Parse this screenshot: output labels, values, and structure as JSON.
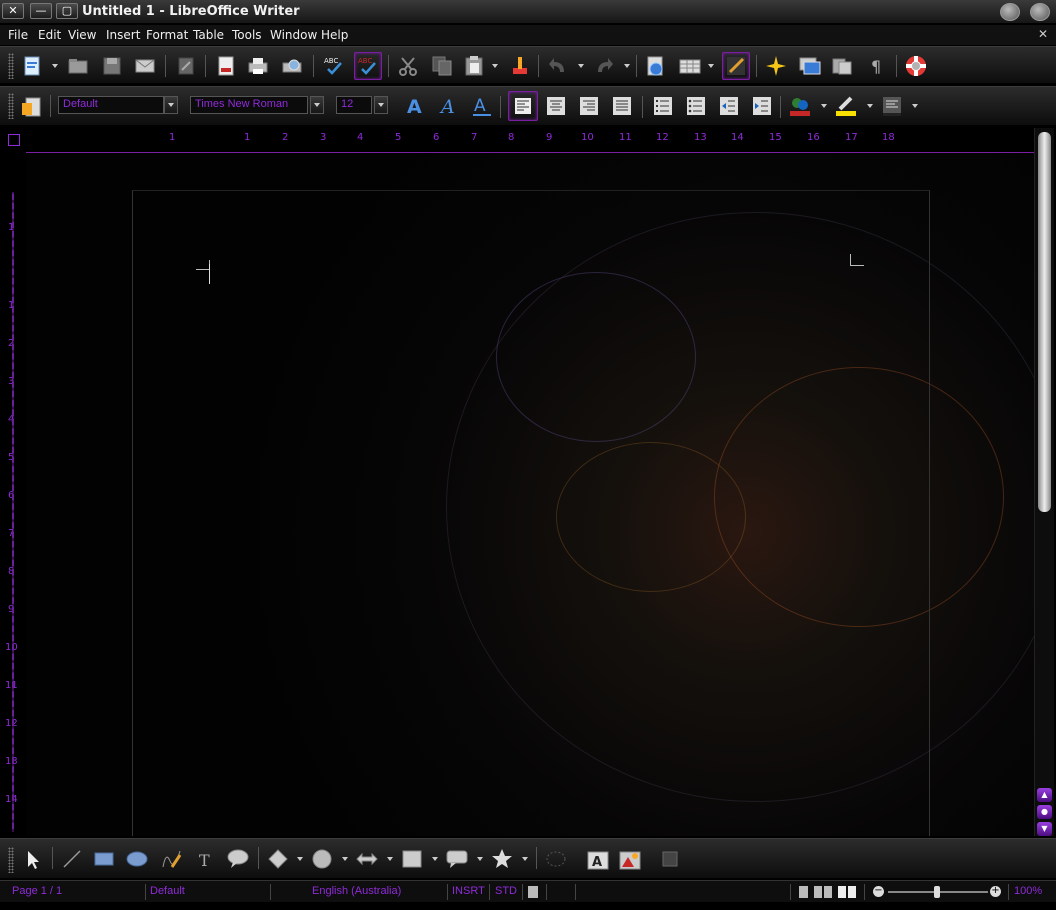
{
  "window": {
    "title": "Untitled 1 - LibreOffice Writer",
    "close_glyph": "✕",
    "minimize_glyph": "—",
    "maximize_glyph": "▢"
  },
  "menu": {
    "items": [
      "File",
      "Edit",
      "View",
      "Insert",
      "Format",
      "Table",
      "Tools",
      "Window",
      "Help"
    ],
    "close_glyph": "✕"
  },
  "formatting": {
    "paragraph_style": "Default",
    "font_name": "Times New Roman",
    "font_size": "12"
  },
  "ruler": {
    "h_labels": [
      "1",
      "1",
      "2",
      "3",
      "4",
      "5",
      "6",
      "7",
      "8",
      "9",
      "10",
      "11",
      "12",
      "13",
      "14",
      "15",
      "16",
      "17",
      "18"
    ],
    "v_labels": [
      "1",
      "1",
      "2",
      "3",
      "4",
      "5",
      "6",
      "7",
      "8",
      "9",
      "10",
      "11",
      "12",
      "13",
      "14"
    ]
  },
  "status": {
    "page": "Page 1 / 1",
    "page_style": "Default",
    "language": "English (Australia)",
    "insert_mode": "INSRT",
    "selection_mode": "STD",
    "zoom": "100%"
  },
  "colors": {
    "accent": "#8f2bd9",
    "background": "#000000"
  },
  "icons": {
    "toolbar1": [
      "new-icon",
      "open-icon",
      "save-icon",
      "email-icon",
      "edit-file-icon",
      "export-pdf-icon",
      "print-icon",
      "print-preview-icon",
      "spellcheck-icon",
      "autospellcheck-icon",
      "cut-icon",
      "copy-icon",
      "paste-icon",
      "clone-formatting-icon",
      "undo-icon",
      "redo-icon",
      "hyperlink-icon",
      "table-icon",
      "show-draw-functions-icon",
      "navigator-icon",
      "gallery-icon",
      "data-sources-icon",
      "formatting-marks-icon",
      "help-icon"
    ],
    "toolbar2": [
      "styles-icon",
      "bold-icon",
      "italic-icon",
      "underline-icon",
      "align-left-icon",
      "align-center-icon",
      "align-right-icon",
      "justify-icon",
      "numbering-icon",
      "bullets-icon",
      "decrease-indent-icon",
      "increase-indent-icon",
      "font-color-icon",
      "highlight-icon",
      "background-color-icon"
    ],
    "drawbar": [
      "select-icon",
      "line-icon",
      "rectangle-icon",
      "ellipse-icon",
      "freeform-icon",
      "text-icon",
      "callout-icon",
      "basic-shapes-icon",
      "symbol-shapes-icon",
      "block-arrows-icon",
      "flowchart-icon",
      "callouts-icon",
      "stars-icon",
      "points-icon",
      "fontwork-icon",
      "from-file-icon",
      "extrusion-icon"
    ]
  }
}
